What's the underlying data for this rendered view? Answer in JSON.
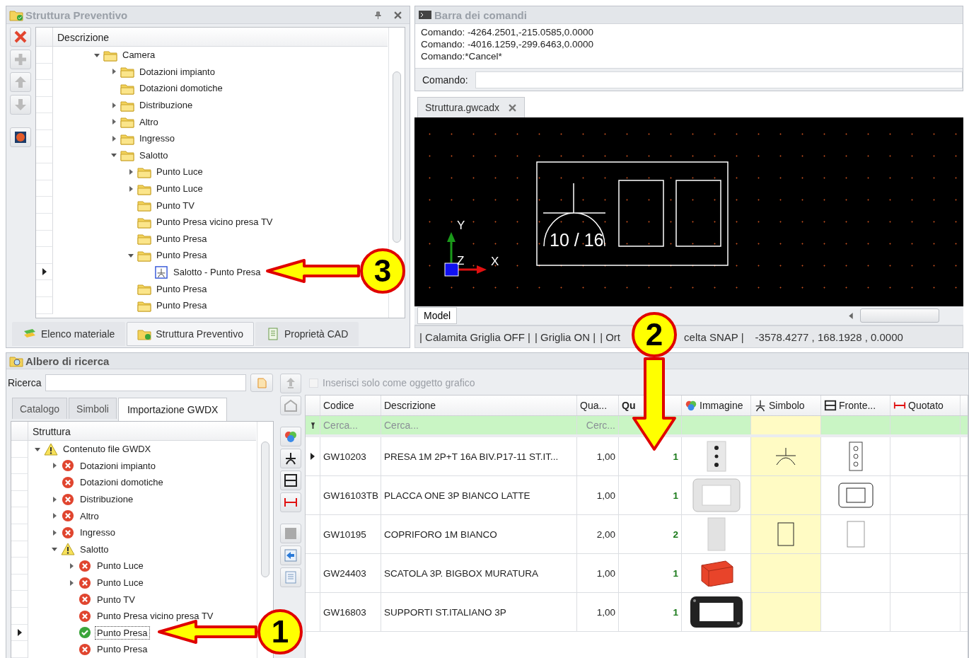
{
  "structure_panel": {
    "title": "Struttura Preventivo",
    "column": "Descrizione",
    "tree": [
      {
        "label": "Camera",
        "kind": "folder",
        "expanded": true,
        "selected": false,
        "children": [
          {
            "label": "Dotazioni impianto",
            "kind": "folder",
            "expanded": false,
            "selected": false
          },
          {
            "label": "Dotazioni domotiche",
            "kind": "folder",
            "selected": false
          },
          {
            "label": "Distribuzione",
            "kind": "folder",
            "expanded": false,
            "selected": false
          },
          {
            "label": "Altro",
            "kind": "folder",
            "expanded": false,
            "selected": false
          },
          {
            "label": "Ingresso",
            "kind": "folder",
            "expanded": false,
            "selected": false
          },
          {
            "label": "Salotto",
            "kind": "folder",
            "expanded": true,
            "selected": false,
            "children": [
              {
                "label": "Punto Luce",
                "kind": "folder",
                "expanded": false,
                "selected": false
              },
              {
                "label": "Punto Luce",
                "kind": "folder",
                "expanded": false,
                "selected": false
              },
              {
                "label": "Punto TV",
                "kind": "folder",
                "selected": false
              },
              {
                "label": "Punto Presa vicino presa TV",
                "kind": "folder",
                "selected": false
              },
              {
                "label": "Punto Presa",
                "kind": "folder",
                "selected": false
              },
              {
                "label": "Punto Presa",
                "kind": "folder",
                "expanded": true,
                "selected": false,
                "children": [
                  {
                    "label": "Salotto - Punto Presa",
                    "kind": "symbol",
                    "selected": true
                  }
                ]
              },
              {
                "label": "Punto Presa",
                "kind": "folder",
                "selected": false
              },
              {
                "label": "Punto Presa",
                "kind": "folder",
                "selected": false
              }
            ]
          }
        ]
      }
    ],
    "tabs": [
      {
        "label": "Elenco materiale",
        "kind": "list",
        "selected": false
      },
      {
        "label": "Struttura Preventivo",
        "kind": "structure",
        "selected": true
      },
      {
        "label": "Proprietà CAD",
        "kind": "properties",
        "selected": false
      }
    ]
  },
  "command_bar": {
    "title": "Barra dei comandi",
    "history": [
      "Comando: -4264.2501,-215.0585,0.0000",
      "Comando: -4016.1259,-299.6463,0.0000",
      "Comando:*Cancel*"
    ],
    "prompt_label": "Comando:"
  },
  "document_tab": {
    "label": "Struttura.gwcadx"
  },
  "cad_view": {
    "symbol_text": "10 / 16",
    "axis_labels": [
      "Y",
      "Z",
      "X"
    ],
    "layout_tab": "Model"
  },
  "status_bar": {
    "items": [
      "| Calamita Griglia OFF |",
      "| Griglia ON |",
      "| Ort",
      "celta SNAP |",
      "-3578.4277 , 168.1928 , 0.0000"
    ]
  },
  "search_panel": {
    "title": "Albero di ricerca",
    "search_label": "Ricerca",
    "tabs": [
      {
        "label": "Catalogo",
        "selected": false
      },
      {
        "label": "Simboli",
        "selected": false
      },
      {
        "label": "Importazione GWDX",
        "selected": true
      }
    ],
    "column": "Struttura",
    "tree": [
      {
        "label": "Contenuto file GWDX",
        "kind": "warning",
        "expanded": true,
        "selected": false,
        "children": [
          {
            "label": "Dotazioni impianto",
            "kind": "error",
            "expanded": false,
            "selected": false
          },
          {
            "label": "Dotazioni domotiche",
            "kind": "error",
            "selected": false
          },
          {
            "label": "Distribuzione",
            "kind": "error",
            "expanded": false,
            "selected": false
          },
          {
            "label": "Altro",
            "kind": "error",
            "expanded": false,
            "selected": false
          },
          {
            "label": "Ingresso",
            "kind": "error",
            "expanded": false,
            "selected": false
          },
          {
            "label": "Salotto",
            "kind": "warning",
            "expanded": true,
            "selected": false,
            "children": [
              {
                "label": "Punto Luce",
                "kind": "error",
                "expanded": false,
                "selected": false
              },
              {
                "label": "Punto Luce",
                "kind": "error",
                "expanded": false,
                "selected": false
              },
              {
                "label": "Punto TV",
                "kind": "error",
                "selected": false
              },
              {
                "label": "Punto Presa vicino presa TV",
                "kind": "error",
                "selected": false
              },
              {
                "label": "Punto Presa",
                "kind": "ok",
                "selected": true
              },
              {
                "label": "Punto Presa",
                "kind": "error",
                "selected": false
              }
            ]
          }
        ]
      }
    ]
  },
  "insert_option": {
    "label": "Inserisci solo come oggetto grafico",
    "checked": false,
    "disabled": true
  },
  "table": {
    "columns": [
      {
        "label": "Codice",
        "kind": "text"
      },
      {
        "label": "Descrizione",
        "kind": "text"
      },
      {
        "label": "Qua...",
        "kind": "text"
      },
      {
        "label": "Qu",
        "kind": "count"
      },
      {
        "label": "Immagine",
        "kind": "image"
      },
      {
        "label": "Simbolo",
        "kind": "symbol"
      },
      {
        "label": "Fronte...",
        "kind": "front"
      },
      {
        "label": "Quotato",
        "kind": "dimension"
      }
    ],
    "filters": [
      {
        "placeholder": "Cerca..."
      },
      {
        "placeholder": "Cerca..."
      },
      {
        "placeholder": "Cerc..."
      }
    ],
    "rows": [
      {
        "code": "GW10203",
        "description": "PRESA 1M 2P+T 16A BIV.P17-11 ST.IT...",
        "quantity": "1,00",
        "count": "1",
        "selected": true
      },
      {
        "code": "GW16103TB",
        "description": "PLACCA ONE 3P BIANCO LATTE",
        "quantity": "1,00",
        "count": "1",
        "selected": false
      },
      {
        "code": "GW10195",
        "description": "COPRIFORO 1M BIANCO",
        "quantity": "2,00",
        "count": "2",
        "selected": false
      },
      {
        "code": "GW24403",
        "description": "SCATOLA 3P. BIGBOX MURATURA",
        "quantity": "1,00",
        "count": "1",
        "selected": false
      },
      {
        "code": "GW16803",
        "description": "SUPPORTI ST.ITALIANO 3P",
        "quantity": "1,00",
        "count": "1",
        "selected": false
      }
    ]
  },
  "callouts": [
    {
      "number": "3"
    },
    {
      "number": "2"
    },
    {
      "number": "1"
    }
  ]
}
